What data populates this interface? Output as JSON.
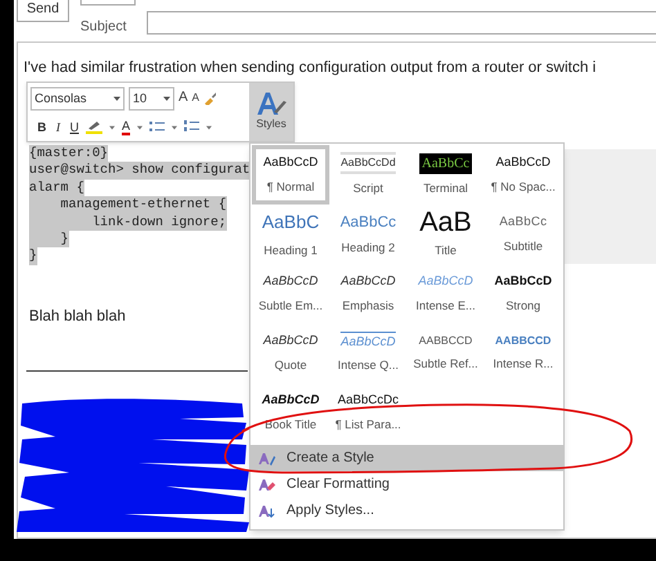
{
  "compose": {
    "send_button": "Send",
    "subject_label": "Subject"
  },
  "body": {
    "intro": "I've had similar frustration when sending configuration output from a router or switch i",
    "code_selected": true,
    "code_lines": [
      "{master:0}",
      "user@switch> show configurat",
      "alarm {",
      "    management-ethernet {",
      "        link-down ignore;",
      "    }",
      "}"
    ],
    "closing": "Blah blah blah"
  },
  "mini_toolbar": {
    "font": "Consolas",
    "size": "10",
    "grow_glyph": "A",
    "shrink_glyph": "A",
    "bold": "B",
    "italic": "I",
    "underline": "U",
    "font_color_glyph": "A",
    "styles_label": "Styles"
  },
  "styles_gallery": {
    "items": [
      {
        "kind": "normal",
        "sample": "AaBbCcD",
        "name": "¶ Normal",
        "selected": true
      },
      {
        "kind": "script",
        "sample": "AaBbCcDd",
        "name": "Script",
        "selected": false
      },
      {
        "kind": "terminal",
        "sample": "AaBbCc",
        "name": "Terminal",
        "selected": false
      },
      {
        "kind": "normal",
        "sample": "AaBbCcD",
        "name": "¶ No Spac...",
        "selected": false
      },
      {
        "kind": "heading1",
        "sample": "AaBbC",
        "name": "Heading 1",
        "selected": false
      },
      {
        "kind": "heading2",
        "sample": "AaBbCc",
        "name": "Heading 2",
        "selected": false
      },
      {
        "kind": "title",
        "sample": "AaB",
        "name": "Title",
        "selected": false
      },
      {
        "kind": "subtitle",
        "sample": "AaBbCc",
        "name": "Subtitle",
        "selected": false
      },
      {
        "kind": "italic",
        "sample": "AaBbCcD",
        "name": "Subtle Em...",
        "selected": false
      },
      {
        "kind": "italic",
        "sample": "AaBbCcD",
        "name": "Emphasis",
        "selected": false
      },
      {
        "kind": "intense_italic",
        "sample": "AaBbCcD",
        "name": "Intense E...",
        "selected": false
      },
      {
        "kind": "strong",
        "sample": "AaBbCcD",
        "name": "Strong",
        "selected": false
      },
      {
        "kind": "italic",
        "sample": "AaBbCcD",
        "name": "Quote",
        "selected": false
      },
      {
        "kind": "intense_quote",
        "sample": "AaBbCcD",
        "name": "Intense Q...",
        "selected": false
      },
      {
        "kind": "caps",
        "sample": "AABBCCD",
        "name": "Subtle Ref...",
        "selected": false
      },
      {
        "kind": "intense_caps",
        "sample": "AABBCCD",
        "name": "Intense R...",
        "selected": false
      },
      {
        "kind": "book",
        "sample": "AaBbCcD",
        "name": "Book Title",
        "selected": false
      },
      {
        "kind": "normal",
        "sample": "AaBbCcDc",
        "name": "¶ List Para...",
        "selected": false
      }
    ],
    "menu": [
      {
        "kind": "create",
        "label": "Create a Style",
        "selected": true
      },
      {
        "kind": "clear",
        "label": "Clear Formatting",
        "selected": false
      },
      {
        "kind": "apply",
        "label": "Apply Styles...",
        "selected": false
      }
    ]
  }
}
